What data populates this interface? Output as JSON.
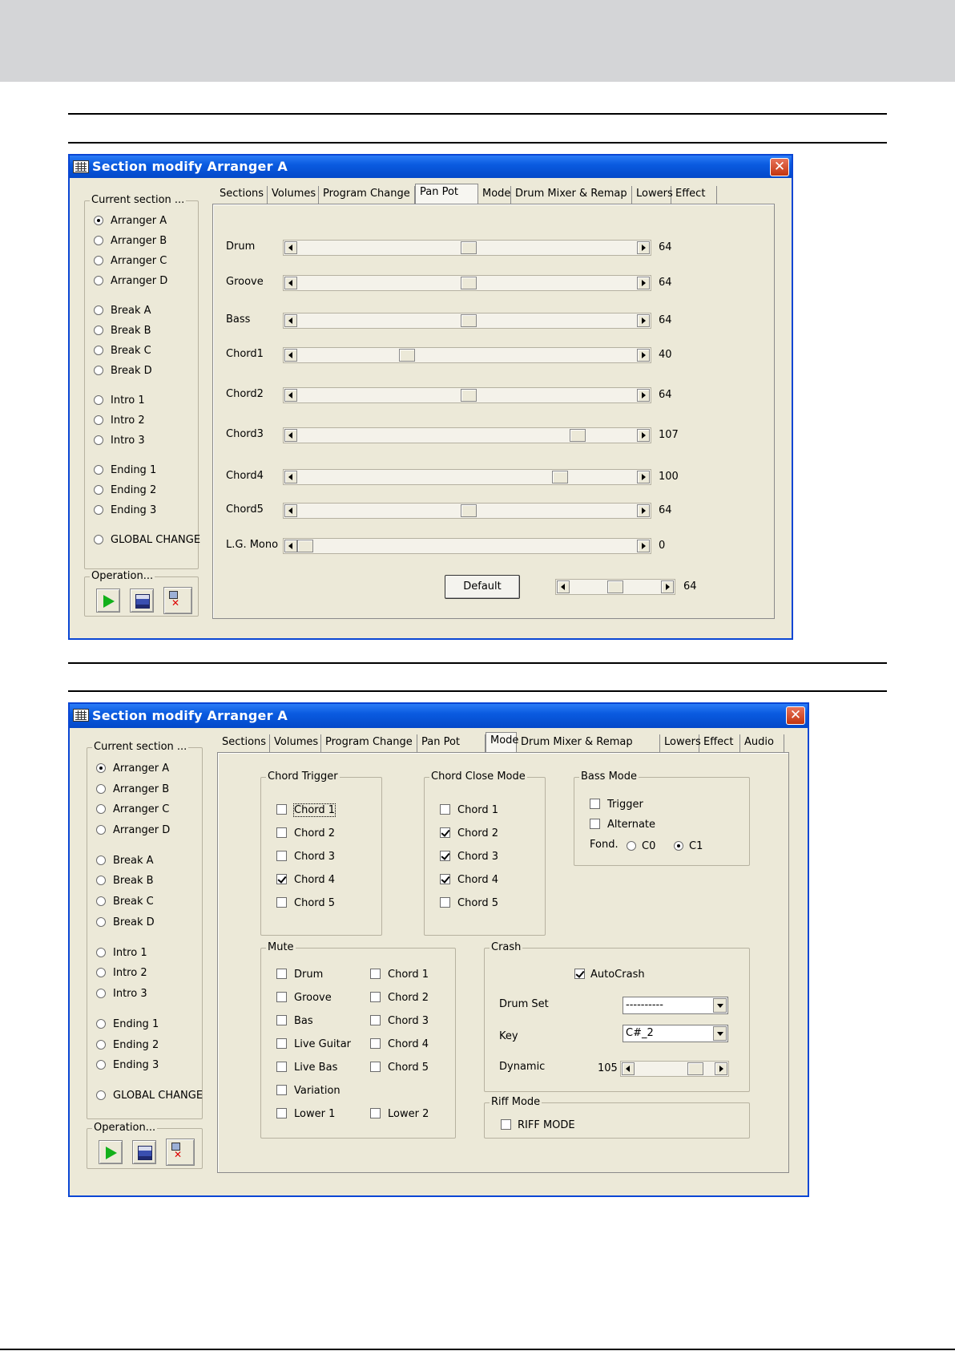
{
  "win1": {
    "title": "Section modify Arranger A",
    "close_glyph": "✕",
    "current_section_label": "Current section ...",
    "sections": [
      "Arranger A",
      "Arranger B",
      "Arranger C",
      "Arranger D",
      "Break A",
      "Break B",
      "Break C",
      "Break D",
      "Intro 1",
      "Intro 2",
      "Intro 3",
      "Ending 1",
      "Ending 2",
      "Ending 3",
      "GLOBAL CHANGE"
    ],
    "selected_section": "Arranger A",
    "operation_label": "Operation...",
    "tabs": [
      "Sections",
      "Volumes",
      "Program Change",
      "Pan Pot",
      "Mode",
      "Drum Mixer & Remap",
      "Lowers",
      "Effect"
    ],
    "active_tab": "Pan Pot",
    "sliders": [
      {
        "label": "Drum",
        "value": "64"
      },
      {
        "label": "Groove",
        "value": "64"
      },
      {
        "label": "Bass",
        "value": "64"
      },
      {
        "label": "Chord1",
        "value": "40"
      },
      {
        "label": "Chord2",
        "value": "64"
      },
      {
        "label": "Chord3",
        "value": "107"
      },
      {
        "label": "Chord4",
        "value": "100"
      },
      {
        "label": "Chord5",
        "value": "64"
      },
      {
        "label": "L.G. Mono",
        "value": "0"
      }
    ],
    "default_button": "Default",
    "default_slider_value": "64",
    "slider_max": 127
  },
  "win2": {
    "title": "Section modify Arranger A",
    "close_glyph": "✕",
    "current_section_label": "Current section ...",
    "sections": [
      "Arranger A",
      "Arranger B",
      "Arranger C",
      "Arranger D",
      "Break A",
      "Break B",
      "Break C",
      "Break D",
      "Intro 1",
      "Intro 2",
      "Intro 3",
      "Ending 1",
      "Ending 2",
      "Ending 3",
      "GLOBAL CHANGE"
    ],
    "operation_label": "Operation...",
    "tabs": [
      "Sections",
      "Volumes",
      "Program Change",
      "Pan Pot",
      "Mode",
      "Drum Mixer & Remap",
      "Lowers",
      "Effect",
      "Audio"
    ],
    "active_tab": "Mode",
    "chord_trigger": {
      "title": "Chord Trigger",
      "items": [
        {
          "label": "Chord 1",
          "checked": false
        },
        {
          "label": "Chord 2",
          "checked": false
        },
        {
          "label": "Chord 3",
          "checked": false
        },
        {
          "label": "Chord 4",
          "checked": true
        },
        {
          "label": "Chord 5",
          "checked": false
        }
      ]
    },
    "chord_close": {
      "title": "Chord Close Mode",
      "items": [
        {
          "label": "Chord 1",
          "checked": false
        },
        {
          "label": "Chord 2",
          "checked": true
        },
        {
          "label": "Chord 3",
          "checked": true
        },
        {
          "label": "Chord 4",
          "checked": true
        },
        {
          "label": "Chord 5",
          "checked": false
        }
      ]
    },
    "bass_mode": {
      "title": "Bass Mode",
      "trigger": "Trigger",
      "alternate": "Alternate",
      "fond_label": "Fond.",
      "c0": "C0",
      "c1": "C1"
    },
    "mute": {
      "title": "Mute",
      "left": [
        "Drum",
        "Groove",
        "Bas",
        "Live Guitar",
        "Live Bas",
        "Variation",
        "Lower 1"
      ],
      "right": [
        "Chord 1",
        "Chord 2",
        "Chord 3",
        "Chord 4",
        "Chord 5",
        "Lower 2"
      ]
    },
    "crash": {
      "title": "Crash",
      "autocrash": "AutoCrash",
      "drum_set_label": "Drum Set",
      "drum_set_value": "----------",
      "key_label": "Key",
      "key_value": "C#_2",
      "dynamic_label": "Dynamic",
      "dynamic_value": "105"
    },
    "riff": {
      "title": "Riff Mode",
      "checkbox": "RIFF MODE"
    }
  }
}
